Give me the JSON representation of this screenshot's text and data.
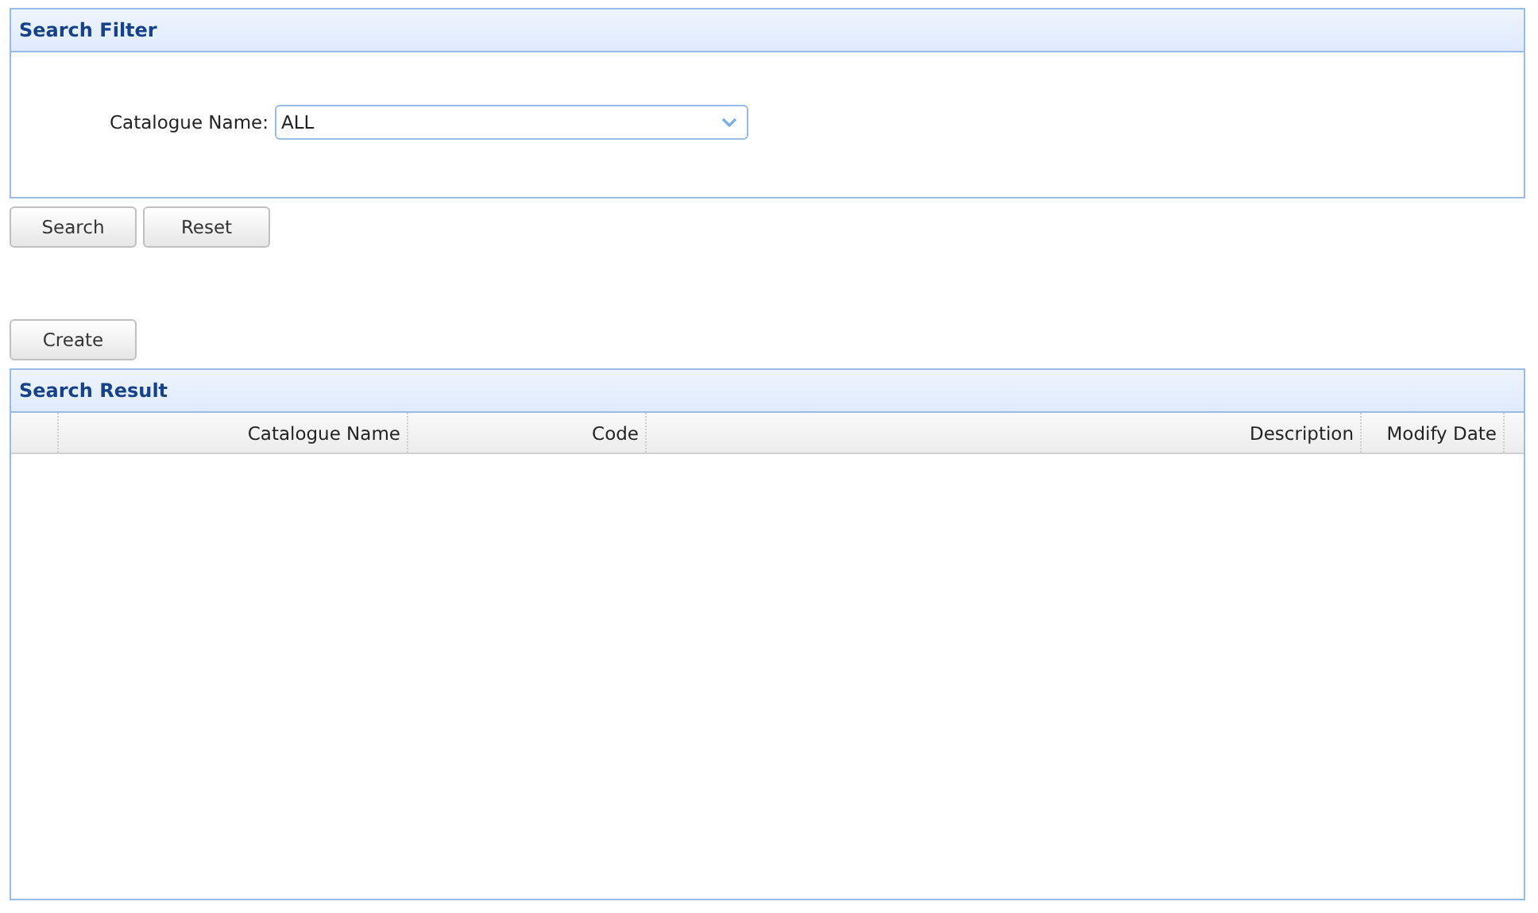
{
  "filter_panel": {
    "title": "Search Filter",
    "field_label": "Catalogue Name:",
    "select_value": "ALL"
  },
  "filter_buttons": [
    "Search",
    "Reset"
  ],
  "create_button": "Create",
  "result_panel": {
    "title": "Search Result",
    "columns": [
      "Catalogue Name",
      "Code",
      "Description",
      "Modify Date"
    ]
  }
}
